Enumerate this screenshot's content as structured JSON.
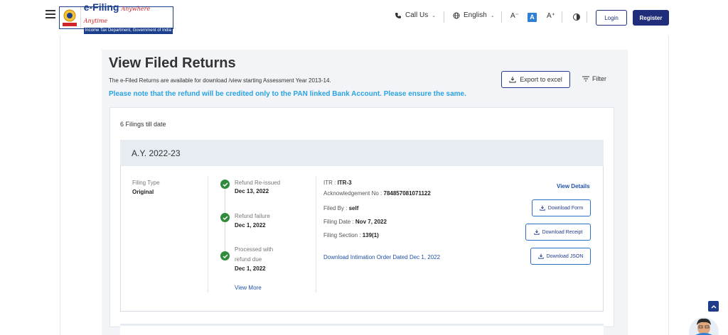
{
  "header": {
    "logo": {
      "title": "e-Filing",
      "tagline": "Anywhere Anytime",
      "department": "Income Tax Department, Government of India"
    },
    "call_us": "Call Us",
    "language": "English",
    "font_decrease": "A⁻",
    "font_normal": "A",
    "font_increase": "A⁺",
    "login": "Login",
    "register": "Register"
  },
  "page": {
    "title": "View Filed Returns",
    "subtitle": "The e-Filed Returns are available for download /view starting Assessment Year 2013-14.",
    "note": "Please note that the refund will be credited only to the PAN linked Bank Account. Please ensure the same.",
    "export_label": "Export to excel",
    "filter_label": "Filter",
    "filings_count": "6 Filings till date"
  },
  "filing": {
    "ay": "A.Y. 2022-23",
    "filing_type_label": "Filing Type",
    "filing_type_value": "Original",
    "timeline": [
      {
        "status": "Refund Re-issued",
        "date": "Dec 13, 2022"
      },
      {
        "status": "Refund failure",
        "date": "Dec 1, 2022"
      },
      {
        "status_line1": "Processed with",
        "status_line2": "refund due",
        "date": "Dec 1, 2022"
      }
    ],
    "view_more": "View More",
    "itr_label": "ITR : ",
    "itr_value": "ITR-3",
    "ack_label": "Acknowledgement No : ",
    "ack_value": "784857081071122",
    "filed_by_label": "Filed By : ",
    "filed_by_value": "self",
    "filing_date_label": "Filing Date : ",
    "filing_date_value": "Nov 7, 2022",
    "filing_section_label": "Filing Section : ",
    "filing_section_value": "139(1)",
    "intimation_link": "Download Intimation Order Dated Dec 1, 2022",
    "view_details": "View Details",
    "download_form": "Download Form",
    "download_receipt": "Download Receipt",
    "download_json": "Download JSON"
  },
  "colors": {
    "primary": "#1f2d7a",
    "accent_blue": "#2aa3e0",
    "success": "#2e8b3a",
    "link": "#1f50a8"
  }
}
